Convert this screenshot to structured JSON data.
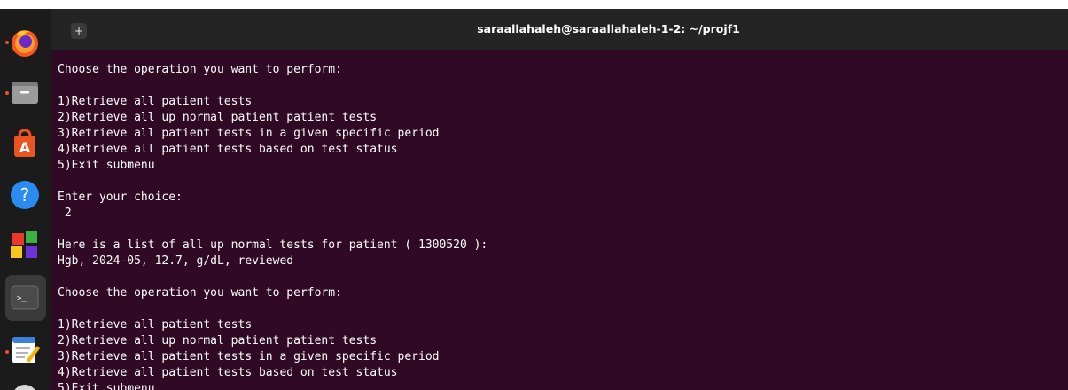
{
  "window": {
    "title": "saraallahaleh@saraallahaleh-1-2: ~/projf1",
    "new_tab_icon": "+"
  },
  "dock": {
    "items": [
      "firefox",
      "files",
      "app-center",
      "help",
      "apps-grid",
      "terminal",
      "text-editor"
    ]
  },
  "terminal": {
    "lines": [
      "Choose the operation you want to perform:",
      "",
      "1)Retrieve all patient tests",
      "2)Retrieve all up normal patient patient tests",
      "3)Retrieve all patient tests in a given specific period",
      "4)Retrieve all patient tests based on test status",
      "5)Exit submenu",
      "",
      "Enter your choice:",
      " 2",
      "",
      "Here is a list of all up normal tests for patient ( 1300520 ):",
      "Hgb, 2024-05, 12.7, g/dL, reviewed",
      "",
      "Choose the operation you want to perform:",
      "",
      "1)Retrieve all patient tests",
      "2)Retrieve all up normal patient patient tests",
      "3)Retrieve all patient tests in a given specific period",
      "4)Retrieve all patient tests based on test status",
      "5)Exit submenu"
    ]
  },
  "colors": {
    "terminal_bg": "#300a24",
    "titlebar_bg": "#242424",
    "dock_bg": "#1b1b1b",
    "accent": "#e95420"
  }
}
